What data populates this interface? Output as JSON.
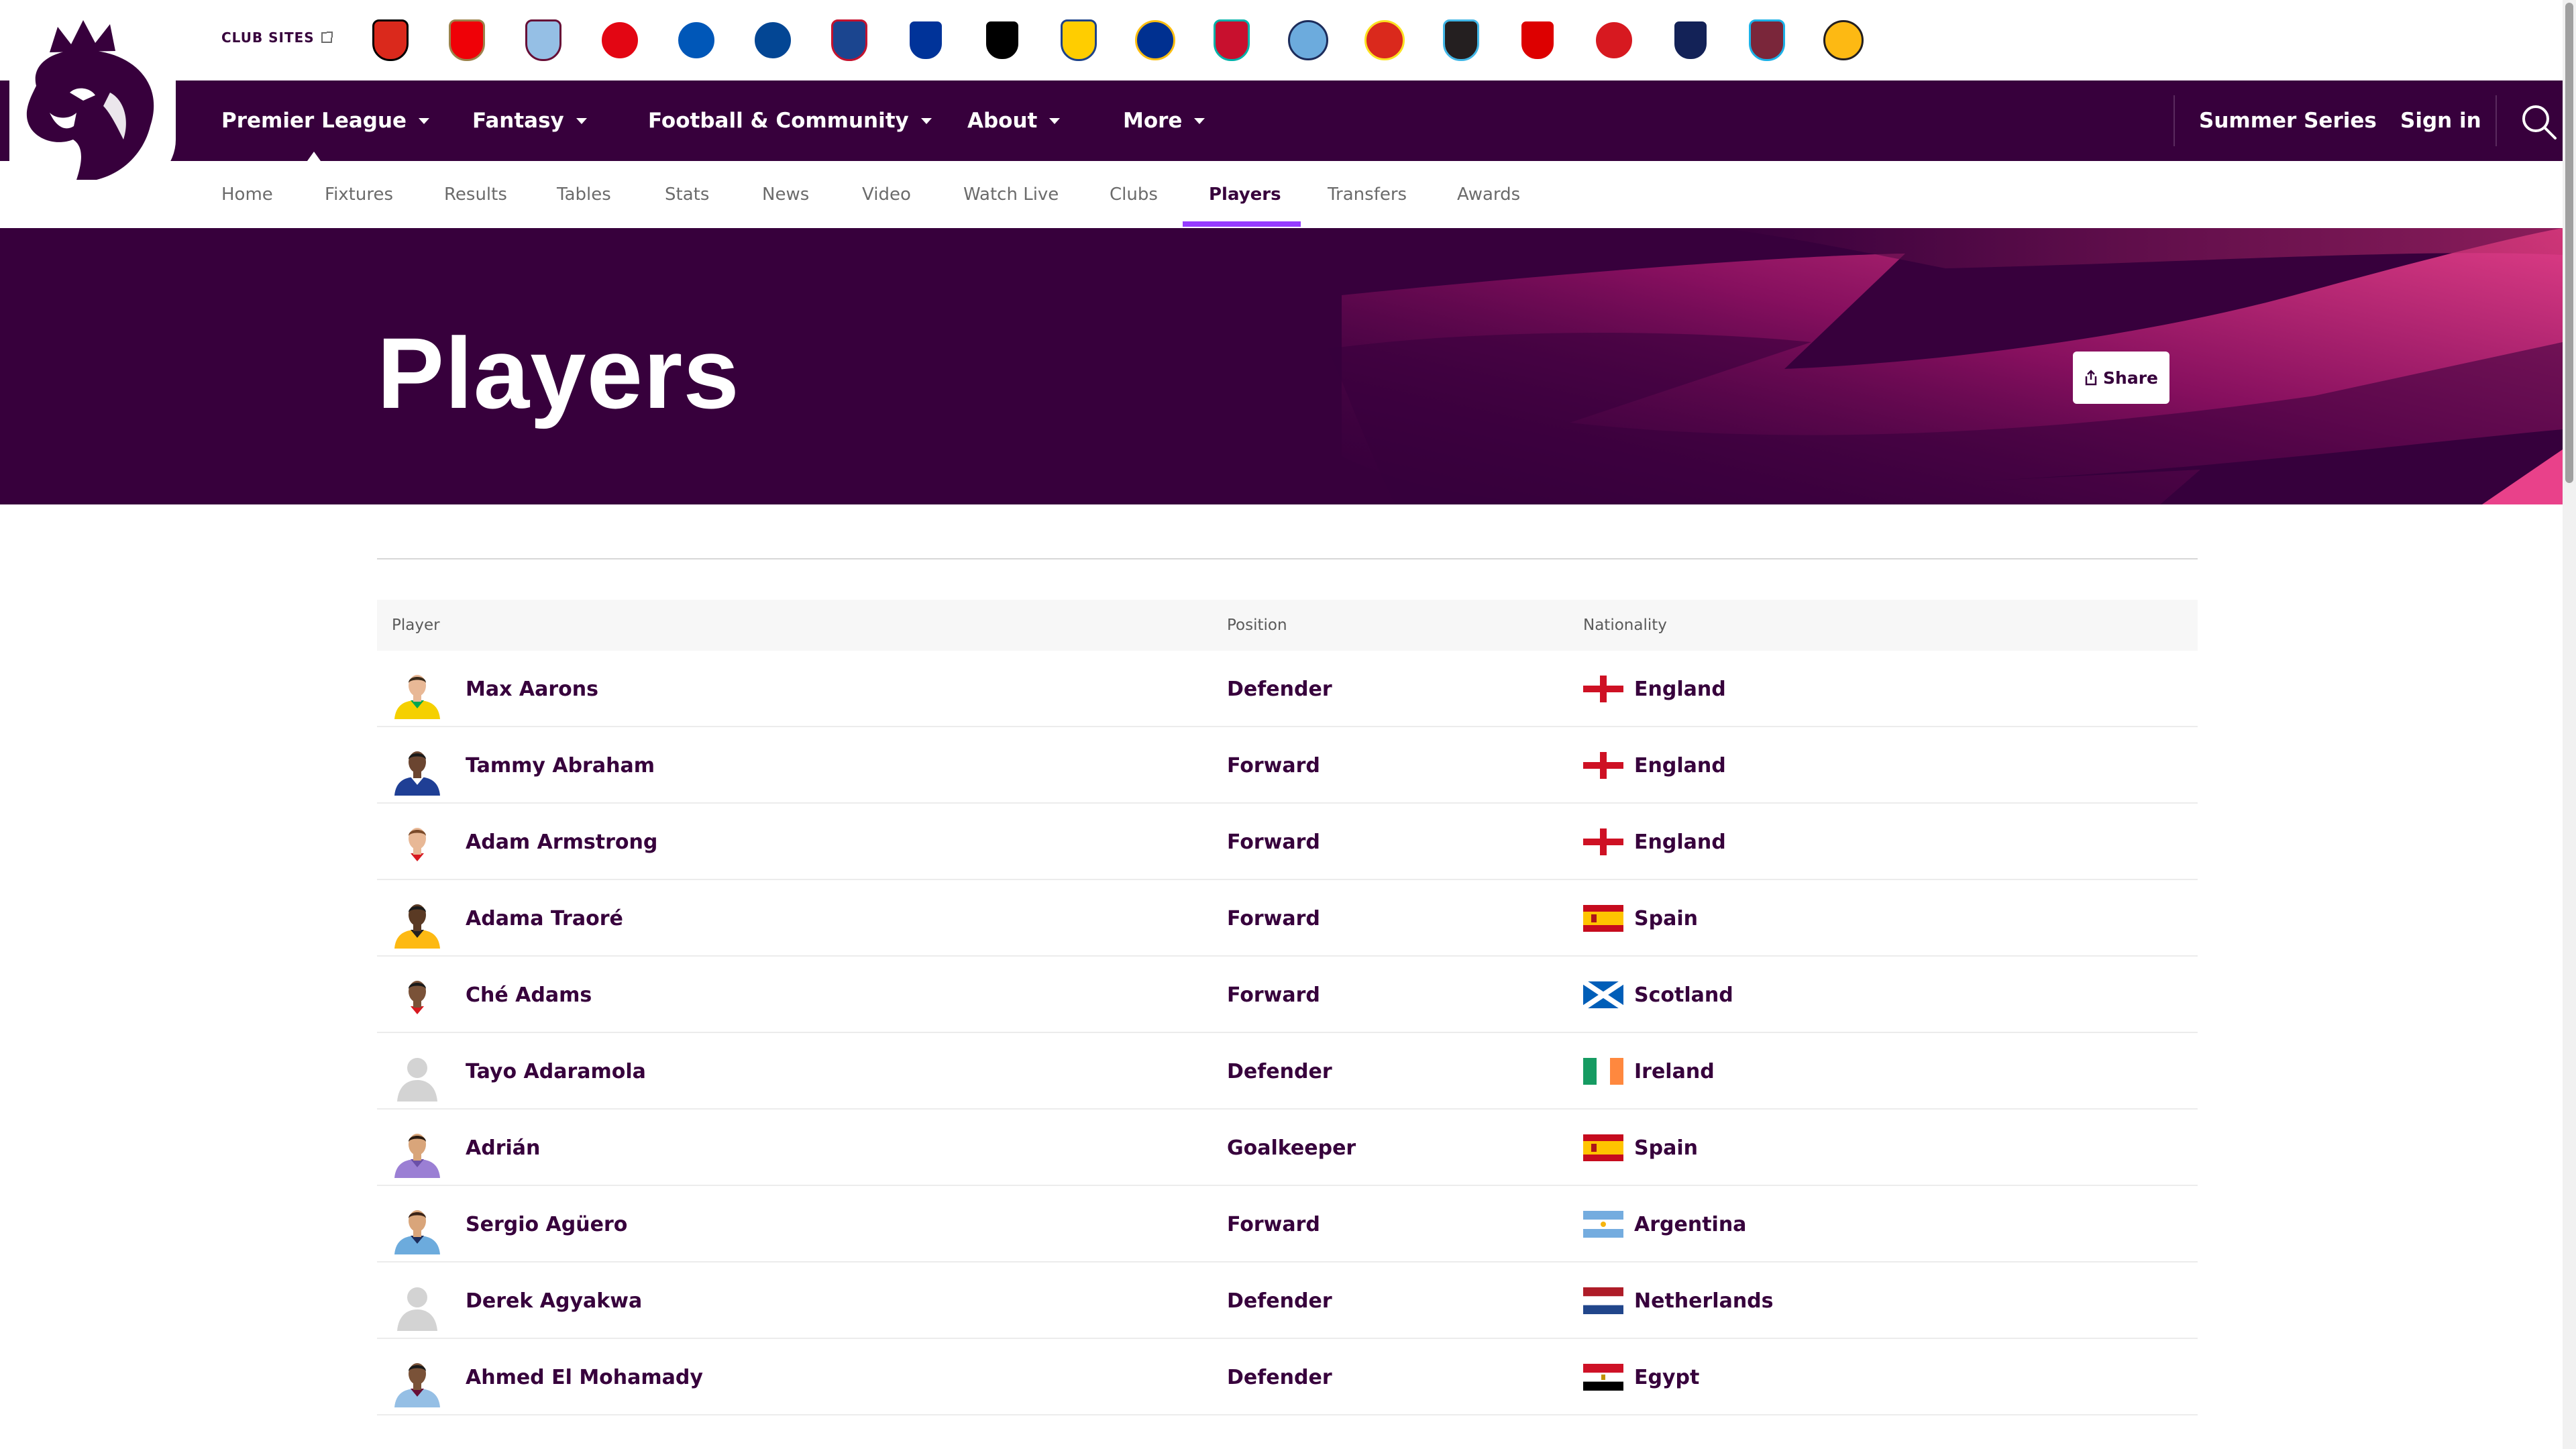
{
  "club_sites": {
    "label": "CLUB SITES",
    "clubs": [
      {
        "name": "Bournemouth-crest-icon",
        "color": "#da291c",
        "accent": "#000000",
        "shape": "shield"
      },
      {
        "name": "Arsenal-crest-icon",
        "color": "#ef0107",
        "accent": "#9c824a",
        "shape": "shield"
      },
      {
        "name": "Aston-Villa-crest-icon",
        "color": "#95bfe5",
        "accent": "#670e36",
        "shape": "shield"
      },
      {
        "name": "Brentford-crest-icon",
        "color": "#e30613",
        "accent": "#ffffff",
        "shape": "round"
      },
      {
        "name": "Brighton-crest-icon",
        "color": "#0057b8",
        "accent": "#ffffff",
        "shape": "round"
      },
      {
        "name": "Chelsea-crest-icon",
        "color": "#034694",
        "accent": "#ffffff",
        "shape": "round"
      },
      {
        "name": "Crystal-Palace-crest-icon",
        "color": "#1b458f",
        "accent": "#c4122e",
        "shape": "shield"
      },
      {
        "name": "Everton-crest-icon",
        "color": "#003399",
        "accent": "#ffffff",
        "shape": "shield"
      },
      {
        "name": "Fulham-crest-icon",
        "color": "#000000",
        "accent": "#ffffff",
        "shape": "shield"
      },
      {
        "name": "Leeds-crest-icon",
        "color": "#ffcd00",
        "accent": "#1d428a",
        "shape": "shield"
      },
      {
        "name": "Leicester-crest-icon",
        "color": "#003090",
        "accent": "#fdbe11",
        "shape": "round"
      },
      {
        "name": "Liverpool-crest-icon",
        "color": "#c8102e",
        "accent": "#00b2a9",
        "shape": "shield"
      },
      {
        "name": "Man-City-crest-icon",
        "color": "#6cabdd",
        "accent": "#1c2c5b",
        "shape": "round"
      },
      {
        "name": "Man-Utd-crest-icon",
        "color": "#da291c",
        "accent": "#fbe122",
        "shape": "round"
      },
      {
        "name": "Newcastle-crest-icon",
        "color": "#241f20",
        "accent": "#41b6e6",
        "shape": "shield"
      },
      {
        "name": "Nottingham-Forest-crest-icon",
        "color": "#dd0000",
        "accent": "#ffffff",
        "shape": "shield"
      },
      {
        "name": "Southampton-crest-icon",
        "color": "#d71920",
        "accent": "#ffffff",
        "shape": "round"
      },
      {
        "name": "Tottenham-crest-icon",
        "color": "#132257",
        "accent": "#ffffff",
        "shape": "shield"
      },
      {
        "name": "West-Ham-crest-icon",
        "color": "#7a263a",
        "accent": "#1bb1e7",
        "shape": "shield"
      },
      {
        "name": "Wolves-crest-icon",
        "color": "#fdb913",
        "accent": "#231f20",
        "shape": "round"
      }
    ]
  },
  "main_nav": {
    "items": [
      "Premier League",
      "Fantasy",
      "Football & Community",
      "About",
      "More"
    ],
    "summer_series": "Summer Series",
    "sign_in": "Sign in"
  },
  "sub_nav": {
    "items": [
      "Home",
      "Fixtures",
      "Results",
      "Tables",
      "Stats",
      "News",
      "Video",
      "Watch Live",
      "Clubs",
      "Players",
      "Transfers",
      "Awards"
    ],
    "active": "Players"
  },
  "hero": {
    "title": "Players",
    "share_label": "Share"
  },
  "table": {
    "headers": {
      "player": "Player",
      "position": "Position",
      "nationality": "Nationality"
    },
    "rows": [
      {
        "name": "Max Aarons",
        "position": "Defender",
        "nationality": "England",
        "flag": "england",
        "kit": "#f5d000",
        "kit_accent": "#00a650",
        "skin": "#e8b896",
        "hair": "#3a2a1a",
        "photo": true
      },
      {
        "name": "Tammy Abraham",
        "position": "Forward",
        "nationality": "England",
        "flag": "england",
        "kit": "#1f3f95",
        "kit_accent": "#ffffff",
        "skin": "#6b4530",
        "hair": "#1a1a1a",
        "photo": true
      },
      {
        "name": "Adam Armstrong",
        "position": "Forward",
        "nationality": "England",
        "flag": "england",
        "kit": "#ffffff",
        "kit_accent": "#d71920",
        "skin": "#e8b896",
        "hair": "#7a4a2a",
        "photo": true
      },
      {
        "name": "Adama Traoré",
        "position": "Forward",
        "nationality": "Spain",
        "flag": "spain",
        "kit": "#fdb913",
        "kit_accent": "#231f20",
        "skin": "#5a3a24",
        "hair": "#1a1a1a",
        "photo": true
      },
      {
        "name": "Ché Adams",
        "position": "Forward",
        "nationality": "Scotland",
        "flag": "scotland",
        "kit": "#ffffff",
        "kit_accent": "#d71920",
        "skin": "#7a5238",
        "hair": "#1a1a1a",
        "photo": true
      },
      {
        "name": "Tayo Adaramola",
        "position": "Defender",
        "nationality": "Ireland",
        "flag": "ireland",
        "kit": "#d0d0d0",
        "kit_accent": "#d0d0d0",
        "skin": "#d0d0d0",
        "hair": "#d0d0d0",
        "photo": false
      },
      {
        "name": "Adrián",
        "position": "Goalkeeper",
        "nationality": "Spain",
        "flag": "spain",
        "kit": "#9b7fd4",
        "kit_accent": "#6a4fa8",
        "skin": "#d9a57a",
        "hair": "#2a1a10",
        "photo": true
      },
      {
        "name": "Sergio Agüero",
        "position": "Forward",
        "nationality": "Argentina",
        "flag": "argentina",
        "kit": "#6cabdd",
        "kit_accent": "#1c2c5b",
        "skin": "#d9a57a",
        "hair": "#3a2418",
        "photo": true
      },
      {
        "name": "Derek Agyakwa",
        "position": "Defender",
        "nationality": "Netherlands",
        "flag": "netherlands",
        "kit": "#d0d0d0",
        "kit_accent": "#d0d0d0",
        "skin": "#d0d0d0",
        "hair": "#d0d0d0",
        "photo": false
      },
      {
        "name": "Ahmed El Mohamady",
        "position": "Defender",
        "nationality": "Egypt",
        "flag": "egypt",
        "kit": "#95bfe5",
        "kit_accent": "#670e36",
        "skin": "#7a5238",
        "hair": "#1a1a1a",
        "photo": true
      }
    ]
  },
  "colors": {
    "brand_purple": "#37003c",
    "accent_pink": "#e90052",
    "active_tab_underline": "#963cff"
  }
}
